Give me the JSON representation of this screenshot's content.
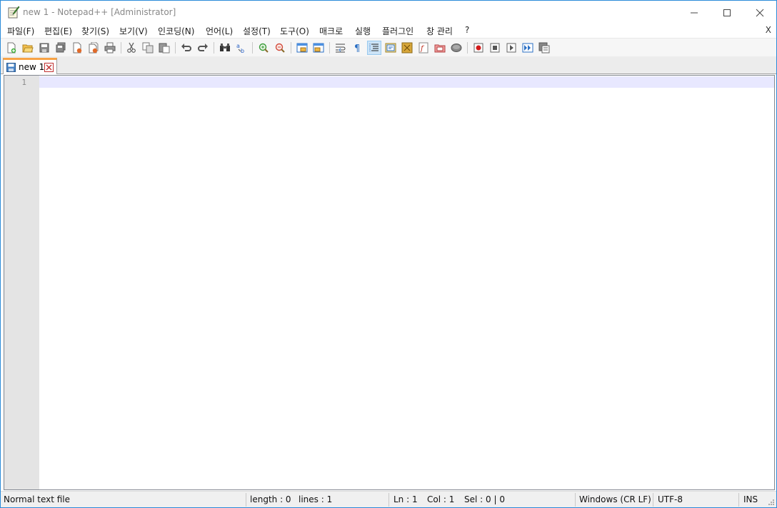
{
  "window": {
    "title": "new 1 - Notepad++ [Administrator]",
    "app_icon": "notepad-icon",
    "controls": [
      "minimize-icon",
      "maximize-icon",
      "close-icon"
    ]
  },
  "menu": {
    "items": [
      "파일(F)",
      "편집(E)",
      "찾기(S)",
      "보기(V)",
      "인코딩(N)",
      "언어(L)",
      "설정(T)",
      "도구(O)",
      "매크로",
      "실행",
      "플러그인",
      "창 관리",
      "?"
    ],
    "close_label": "X"
  },
  "toolbar": {
    "icons": [
      "new-file-icon",
      "open-file-icon",
      "save-icon",
      "save-all-icon",
      "close-icon",
      "close-all-icon",
      "print-icon",
      "cut-icon",
      "copy-icon",
      "paste-icon",
      "undo-icon",
      "redo-icon",
      "find-icon",
      "replace-icon",
      "zoom-in-icon",
      "zoom-out-icon",
      "sync-vertical-icon",
      "sync-horizontal-icon",
      "word-wrap-icon",
      "show-all-chars-icon",
      "indent-guide-icon",
      "user-language-icon",
      "doc-map-icon",
      "function-list-icon",
      "folder-workspace-icon",
      "monitoring-icon",
      "record-macro-icon",
      "stop-macro-icon",
      "play-macro-icon",
      "run-macro-multiple-icon",
      "save-macro-icon"
    ],
    "active": "indent-guide-icon"
  },
  "tabs": [
    {
      "label": "new 1",
      "icon": "saved-file-icon",
      "close_icon": "tab-close-icon",
      "active": true
    }
  ],
  "editor": {
    "line_numbers": [
      "1"
    ],
    "content": "",
    "colors": {
      "gutter": "#e4e4e4",
      "caret_line": "#e8e8ff",
      "tab_accent": "#f8a345"
    }
  },
  "status": {
    "file_type": "Normal text file",
    "length": "length : 0",
    "lines": "lines : 1",
    "ln": "Ln : 1",
    "col": "Col : 1",
    "sel": "Sel : 0 | 0",
    "eol": "Windows (CR LF)",
    "encoding": "UTF-8",
    "mode": "INS"
  }
}
